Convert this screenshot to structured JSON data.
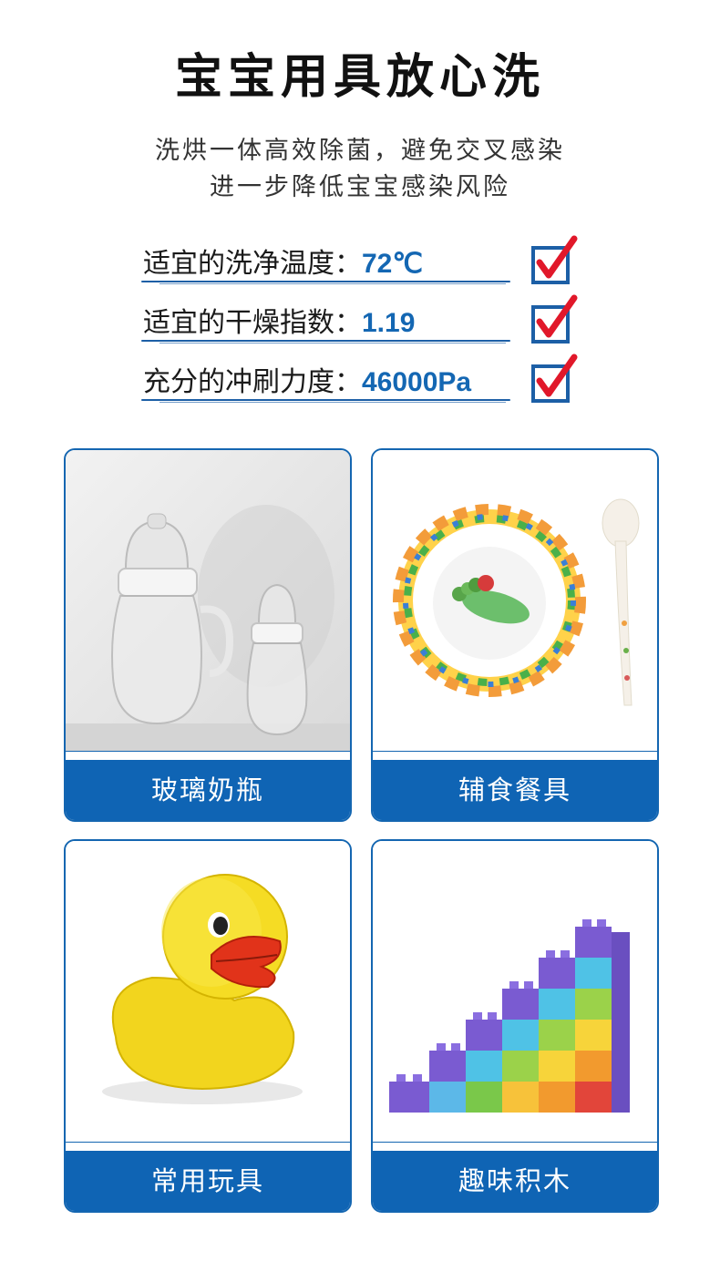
{
  "title": "宝宝用具放心洗",
  "subtitle": [
    "洗烘一体高效除菌，避免交叉感染",
    "进一步降低宝宝感染风险"
  ],
  "specs": [
    {
      "label": "适宜的洗净温度：",
      "value": "72℃",
      "checked": true
    },
    {
      "label": "适宜的干燥指数：",
      "value": "1.19",
      "checked": true
    },
    {
      "label": "充分的冲刷力度：",
      "value": "46000Pa",
      "checked": true
    }
  ],
  "cards": [
    {
      "label": "玻璃奶瓶",
      "image": "glass-baby-bottles"
    },
    {
      "label": "辅食餐具",
      "image": "bowl-and-spoon"
    },
    {
      "label": "常用玩具",
      "image": "rubber-duck"
    },
    {
      "label": "趣味积木",
      "image": "building-blocks"
    }
  ],
  "colors": {
    "accent": "#0f64b4",
    "value": "#1467b3",
    "check": "#e1182a"
  }
}
